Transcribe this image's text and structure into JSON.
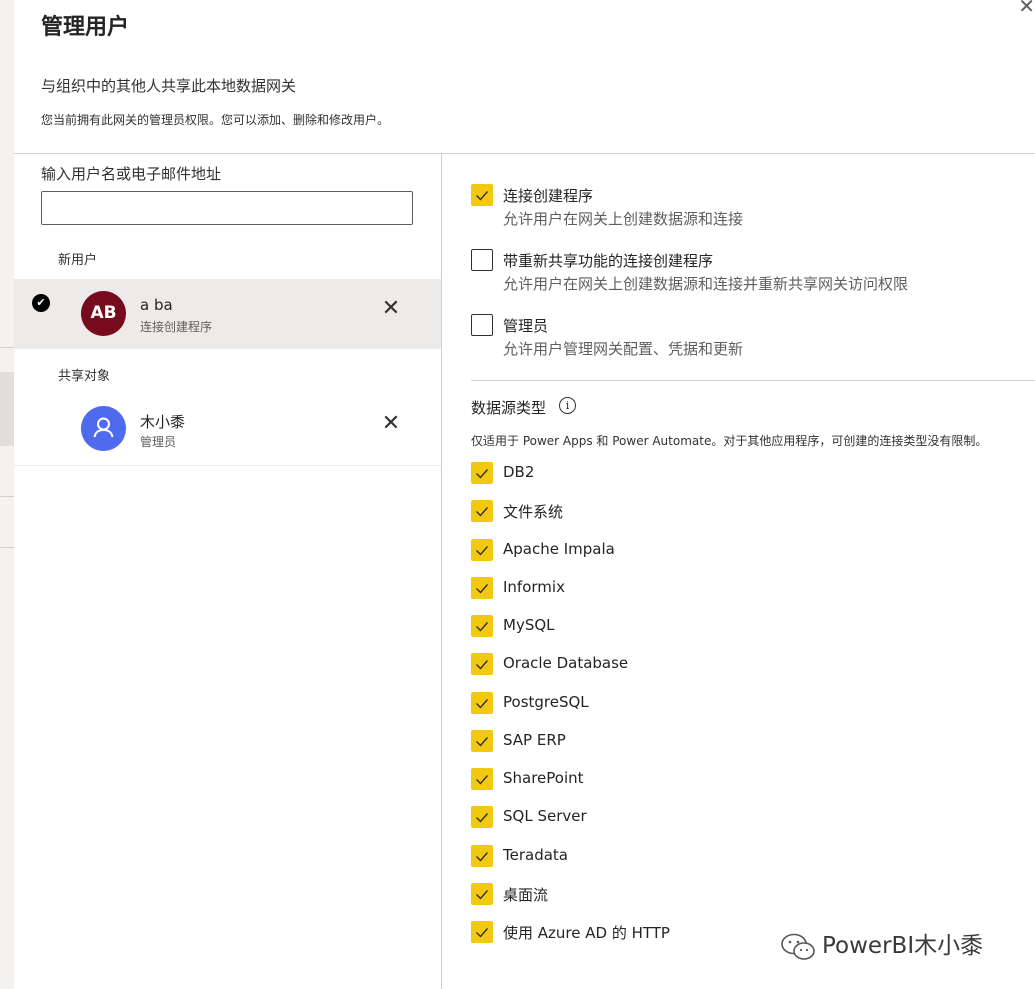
{
  "dialog": {
    "title": "管理用户",
    "close_icon": "✕",
    "subtitle": "与组织中的其他人共享此本地数据网关",
    "description": "您当前拥有此网关的管理员权限。您可以添加、删除和修改用户。"
  },
  "left": {
    "input_label": "输入用户名或电子邮件地址",
    "input_value": "",
    "new_users_label": "新用户",
    "new_users": [
      {
        "initials": "AB",
        "name": "a ba",
        "role": "连接创建程序",
        "selected": true,
        "avatar_color": "#750b1c"
      }
    ],
    "shared_label": "共享对象",
    "shared_users": [
      {
        "name": "木小黍",
        "role": "管理员",
        "avatar_icon": "person-icon",
        "avatar_color": "#4f6bed"
      }
    ],
    "remove_icon": "✕"
  },
  "permissions": [
    {
      "title": "连接创建程序",
      "desc": "允许用户在网关上创建数据源和连接",
      "checked": true
    },
    {
      "title": "带重新共享功能的连接创建程序",
      "desc": "允许用户在网关上创建数据源和连接并重新共享网关访问权限",
      "checked": false
    },
    {
      "title": "管理员",
      "desc": "允许用户管理网关配置、凭据和更新",
      "checked": false
    }
  ],
  "datasource": {
    "title": "数据源类型",
    "info_icon": "i",
    "note": "仅适用于 Power Apps 和 Power Automate。对于其他应用程序，可创建的连接类型没有限制。",
    "types": [
      {
        "label": "DB2",
        "checked": true
      },
      {
        "label": "文件系统",
        "checked": true
      },
      {
        "label": "Apache Impala",
        "checked": true
      },
      {
        "label": "Informix",
        "checked": true
      },
      {
        "label": "MySQL",
        "checked": true
      },
      {
        "label": "Oracle Database",
        "checked": true
      },
      {
        "label": "PostgreSQL",
        "checked": true
      },
      {
        "label": "SAP ERP",
        "checked": true
      },
      {
        "label": "SharePoint",
        "checked": true
      },
      {
        "label": "SQL Server",
        "checked": true
      },
      {
        "label": "Teradata",
        "checked": true
      },
      {
        "label": "桌面流",
        "checked": true
      },
      {
        "label": "使用 Azure AD 的 HTTP",
        "checked": true
      }
    ]
  },
  "watermark": {
    "text": "PowerBI木小黍",
    "icon": "wechat-icon"
  },
  "colors": {
    "accent": "#f2c811",
    "text": "#252423",
    "muted": "#605e5c",
    "selected_row": "#edebe9"
  }
}
